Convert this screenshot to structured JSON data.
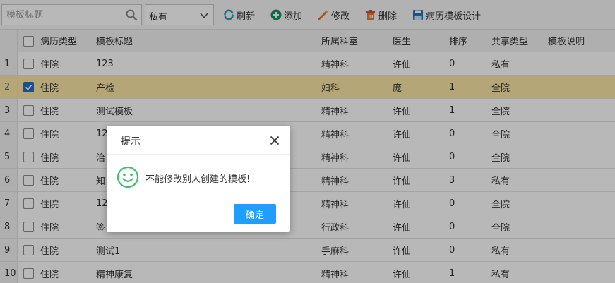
{
  "toolbar": {
    "search_placeholder": "模板标题",
    "type_select_value": "私有",
    "buttons": [
      {
        "label": "刷新",
        "icon": "refresh-icon"
      },
      {
        "label": "添加",
        "icon": "plus-circle-icon"
      },
      {
        "label": "修改",
        "icon": "pencil-icon"
      },
      {
        "label": "删除",
        "icon": "trash-icon"
      },
      {
        "label": "病历模板设计",
        "icon": "save-icon"
      }
    ]
  },
  "table": {
    "columns": [
      "病历类型",
      "模板标题",
      "所属科室",
      "医生",
      "排序",
      "共享类型",
      "模板说明"
    ],
    "rows": [
      {
        "num": "1",
        "checked": false,
        "type": "住院",
        "title": "123",
        "dept": "精神科",
        "doctor": "许仙",
        "order": "0",
        "share": "私有"
      },
      {
        "num": "2",
        "checked": true,
        "type": "住院",
        "title": "产检",
        "dept": "妇科",
        "doctor": "庞",
        "order": "1",
        "share": "全院"
      },
      {
        "num": "3",
        "checked": false,
        "type": "住院",
        "title": "测试模板",
        "dept": "精神科",
        "doctor": "许仙",
        "order": "1",
        "share": "全院"
      },
      {
        "num": "4",
        "checked": false,
        "type": "住院",
        "title": "12",
        "dept": "精神科",
        "doctor": "许仙",
        "order": "0",
        "share": "全院"
      },
      {
        "num": "5",
        "checked": false,
        "type": "住院",
        "title": "治",
        "dept": "精神科",
        "doctor": "许仙",
        "order": "0",
        "share": "全院"
      },
      {
        "num": "6",
        "checked": false,
        "type": "住院",
        "title": "知",
        "dept": "精神科",
        "doctor": "许仙",
        "order": "3",
        "share": "私有"
      },
      {
        "num": "7",
        "checked": false,
        "type": "住院",
        "title": "12",
        "dept": "精神科",
        "doctor": "许仙",
        "order": "0",
        "share": "全院"
      },
      {
        "num": "8",
        "checked": false,
        "type": "住院",
        "title": "签",
        "dept": "行政科",
        "doctor": "许仙",
        "order": "0",
        "share": "全院"
      },
      {
        "num": "9",
        "checked": false,
        "type": "住院",
        "title": "测试1",
        "dept": "手麻科",
        "doctor": "许仙",
        "order": "0",
        "share": "私有"
      },
      {
        "num": "10",
        "checked": false,
        "type": "住院",
        "title": "精神康复",
        "dept": "精神科",
        "doctor": "许仙",
        "order": "1",
        "share": "私有"
      }
    ]
  },
  "dialog": {
    "title": "提示",
    "message": "不能修改别人创建的模板!",
    "ok_label": "确定",
    "icon": "smile-icon"
  },
  "colors": {
    "selected_row": "#fbe6a6",
    "primary_button": "#1e9fff",
    "success_icon": "#3fbf6b"
  }
}
